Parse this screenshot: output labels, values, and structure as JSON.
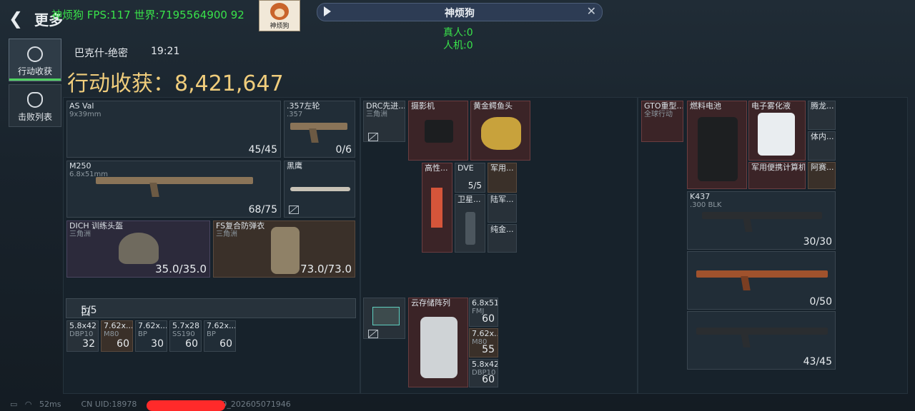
{
  "header": {
    "back_icon": "chevron-left-icon",
    "back_label": "更多",
    "player_name": "神烦狗",
    "fps_text": "FPS:117",
    "world_text": "世界:7195564900 92",
    "avatar_label": "神烦狗",
    "music_title": "神烦狗",
    "real_players": "真人:0",
    "bots": "人机:0"
  },
  "sidebar": {
    "tabs": [
      {
        "label": "行动收获",
        "icon": "target-icon",
        "active": true
      },
      {
        "label": "击败列表",
        "icon": "skull-icon",
        "active": false
      }
    ]
  },
  "summary": {
    "map": "巴克什-绝密",
    "time": "19:21",
    "harvest_label": "行动收获：",
    "harvest_value": "8,421,647"
  },
  "loadout": {
    "primary": {
      "name": "AS Val",
      "ammo": "9x39mm",
      "count": "45/45"
    },
    "pistol": {
      "name": ".357左轮",
      "ammo": ".357",
      "count": "0/6"
    },
    "secondary": {
      "name": "M250",
      "ammo": "6.8x51mm",
      "count": "68/75"
    },
    "melee": {
      "name": "黑鹰"
    },
    "helmet": {
      "name": "DICH 训练头盔",
      "sub": "三角洲",
      "durability": "35.0/35.0"
    },
    "armor": {
      "name": "FS复合防弹衣",
      "sub": "三角洲",
      "durability": "73.0/73.0"
    }
  },
  "pockets": {
    "label": "口袋：",
    "count": "5/5",
    "items": [
      {
        "name": "5.8x42",
        "sub": "DBP10",
        "count": "32"
      },
      {
        "name": "7.62x...",
        "sub": "M80",
        "count": "60"
      },
      {
        "name": "7.62x...",
        "sub": "BP",
        "count": "30"
      },
      {
        "name": "5.7x28",
        "sub": "SS190",
        "count": "60"
      },
      {
        "name": "7.62x...",
        "sub": "BP",
        "count": "60"
      }
    ]
  },
  "middle": {
    "chest_rig": {
      "name": "DRC先进...",
      "sub": "三角洲"
    },
    "camera": {
      "name": "摄影机"
    },
    "croc_head": {
      "name": "黄金鳄鱼头"
    },
    "high_perf": {
      "name": "高性..."
    },
    "dve": {
      "name": "DVE",
      "count": "5/5"
    },
    "satellite": {
      "name": "卫星..."
    },
    "military1": {
      "name": "军用..."
    },
    "army": {
      "name": "陆军..."
    },
    "gold": {
      "name": "纯金..."
    },
    "cloud_storage": {
      "name": "云存储阵列"
    },
    "ammo_list": [
      {
        "name": "6.8x51",
        "sub": "FMJ",
        "count": "60"
      },
      {
        "name": "7.62x...",
        "sub": "M80",
        "count": "55"
      },
      {
        "name": "5.8x42",
        "sub": "DBP10",
        "count": "60"
      }
    ]
  },
  "right": {
    "backpack": {
      "name": "GTO重型...",
      "sub": "全球行动"
    },
    "fuel_cell": {
      "name": "燃料电池"
    },
    "electrolyte": {
      "name": "电子雾化液"
    },
    "tenglong": {
      "name": "腾龙..."
    },
    "body": {
      "name": "体内..."
    },
    "military_laptop": {
      "name": "军用便携计算机"
    },
    "afternoon": {
      "name": "阿赛..."
    },
    "rifle1": {
      "name": "K437",
      "sub": ".300 BLK",
      "count": "30/30"
    },
    "rifle2": {
      "count": "0/50"
    },
    "rifle3": {
      "count": "43/45"
    }
  },
  "footer": {
    "ping": "52ms",
    "uid_prefix": "CN UID:18978",
    "uid_suffix": "09_202605071946"
  }
}
